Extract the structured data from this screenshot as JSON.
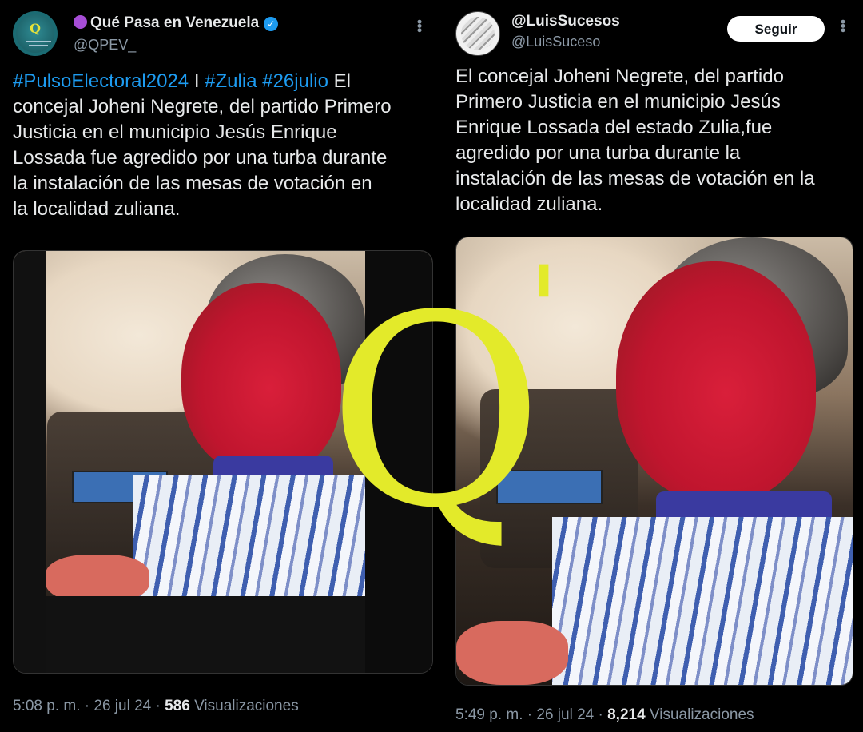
{
  "colors": {
    "background": "#000000",
    "hashtag": "#1d9bf0",
    "verified": "#1d9bf0",
    "watermark": "#e3ea2a",
    "muted": "#8b98a5"
  },
  "tweet_left": {
    "display_name": "Qué Pasa en Venezuela",
    "handle": "@QPEV_",
    "status_icon": "purple-circle-icon",
    "verified_icon": "verified-badge-icon",
    "more_icon": "more-options-icon",
    "hashtags": [
      "#PulsoElectoral2024",
      "#Zulia",
      "#26julio"
    ],
    "separator": "I",
    "text_lines": [
      "El",
      "concejal Joheni Negrete, del partido Primero",
      "Justicia en el municipio Jesús Enrique",
      "Lossada fue agredido por una turba durante",
      "la instalación de las mesas de votación en",
      "la localidad zuliana."
    ],
    "time": "5:08 p. m. · 26 jul 24 · ",
    "views_count": "586",
    "views_label": "Visualizaciones"
  },
  "tweet_right": {
    "display_name": "@LuisSucesos",
    "handle": "@LuisSuceso",
    "follow_label": "Seguir",
    "more_icon": "more-options-icon",
    "text_lines": [
      "El concejal Joheni Negrete, del partido",
      "Primero Justicia en el municipio Jesús",
      "Enrique Lossada del estado Zulia,fue",
      "agredido por una turba durante la",
      "instalación de las mesas de votación en la",
      "localidad zuliana."
    ],
    "time": "5:49 p. m. · 26 jul 24 · ",
    "views_count": "8,214",
    "views_label": "Visualizaciones"
  },
  "watermark": {
    "letter": "Q",
    "mark": "'"
  }
}
